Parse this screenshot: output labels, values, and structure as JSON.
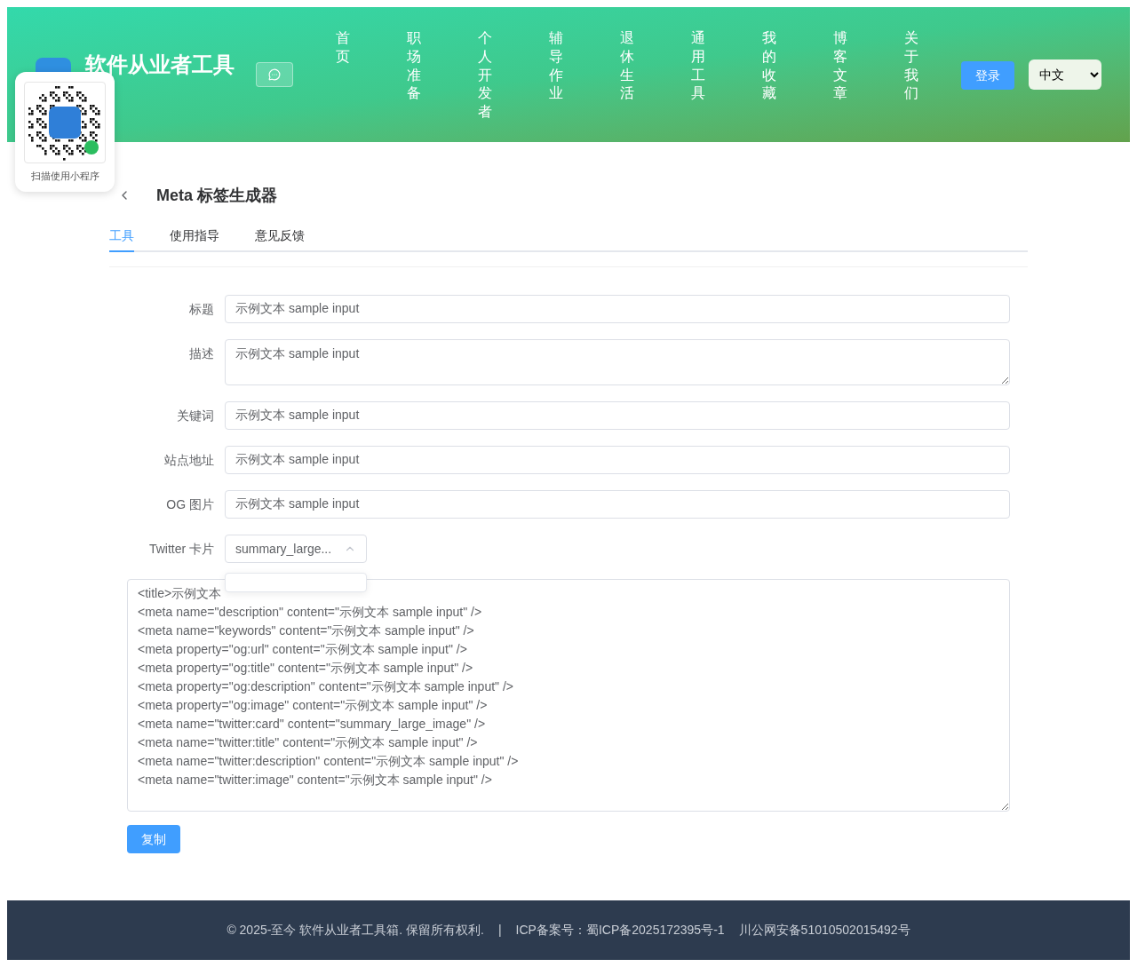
{
  "header": {
    "title": "软件从业者工具",
    "nav": [
      {
        "label": "首页"
      },
      {
        "label": "职场准备"
      },
      {
        "label": "个人开发者"
      },
      {
        "label": "辅导作业"
      },
      {
        "label": "退休生活"
      },
      {
        "label": "通用工具"
      },
      {
        "label": "我的收藏"
      },
      {
        "label": "博客文章"
      },
      {
        "label": "关于我们"
      }
    ],
    "login": "登录",
    "language": "中文"
  },
  "qr_card": {
    "caption": "扫描使用小程序"
  },
  "page": {
    "title": "Meta 标签生成器",
    "tabs": [
      {
        "label": "工具",
        "selected": true
      },
      {
        "label": "使用指导",
        "selected": false
      },
      {
        "label": "意见反馈",
        "selected": false
      }
    ]
  },
  "form": [
    {
      "kind": "input",
      "label": "标题",
      "value": "示例文本 sample input"
    },
    {
      "kind": "textarea",
      "label": "描述",
      "value": "示例文本 sample input"
    },
    {
      "kind": "input",
      "label": "关键词",
      "value": "示例文本 sample input"
    },
    {
      "kind": "input",
      "label": "站点地址",
      "value": "示例文本 sample input"
    },
    {
      "kind": "input",
      "label": "OG 图片",
      "value": "示例文本 sample input"
    },
    {
      "kind": "select",
      "label": "Twitter 卡片",
      "value": "summary_large...",
      "expanded": true
    }
  ],
  "output": {
    "lines": [
      "<title>示例文本",
      "<meta name=\"description\" content=\"示例文本 sample input\" />",
      "<meta name=\"keywords\" content=\"示例文本 sample input\" />",
      "<meta property=\"og:url\" content=\"示例文本 sample input\" />",
      "<meta property=\"og:title\" content=\"示例文本 sample input\" />",
      "<meta property=\"og:description\" content=\"示例文本 sample input\" />",
      "<meta property=\"og:image\" content=\"示例文本 sample input\" />",
      "<meta name=\"twitter:card\" content=\"summary_large_image\" />",
      "<meta name=\"twitter:title\" content=\"示例文本 sample input\" />",
      "<meta name=\"twitter:description\" content=\"示例文本 sample input\" />",
      "<meta name=\"twitter:image\" content=\"示例文本 sample input\" />"
    ]
  },
  "copy_button": "复制",
  "footer": {
    "copyright": "© 2025-至今 软件从业者工具箱. 保留所有权利.",
    "separator": "|",
    "icp": "ICP备案号：蜀ICP备2025172395号-1",
    "police": "川公网安备51010502015492号"
  }
}
